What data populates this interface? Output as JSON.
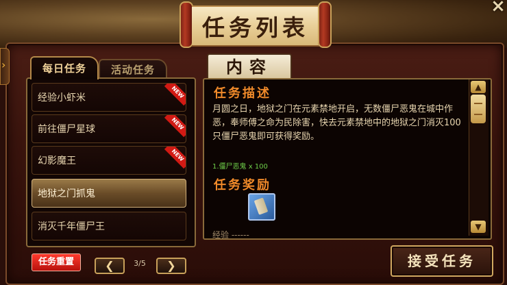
{
  "window": {
    "title": "任务列表",
    "close_label": "×",
    "side_arrow": "›"
  },
  "tabs": [
    {
      "label": "每日任务",
      "active": true
    },
    {
      "label": "活动任务",
      "active": false
    }
  ],
  "tasks": [
    {
      "label": "经验小虾米",
      "badge": "NEW"
    },
    {
      "label": "前往僵尸星球",
      "badge": "NEW"
    },
    {
      "label": "幻影魔王",
      "badge": "NEW"
    },
    {
      "label": "地狱之门抓鬼",
      "selected": true
    },
    {
      "label": "消灭千年僵尸王"
    }
  ],
  "pager": {
    "reset_label": "任务重置",
    "prev": "❮",
    "next": "❯",
    "page_text": "3/5"
  },
  "content": {
    "tab_label": "内容",
    "desc_title": "任务描述",
    "desc_text": "月圆之日，地狱之门在元素禁地开启，无数僵尸恶鬼在城中作恶，奉师傅之命为民除害，快去元素禁地中的地狱之门消灭100只僵尸恶鬼即可获得奖励。",
    "goal": "1.僵尸恶鬼 x 100",
    "reward_title": "任务奖励",
    "reward_icon": "scroll-item-icon",
    "exp_text": "经验 ------"
  },
  "scrollbar": {
    "up": "▲",
    "down": "▼"
  },
  "accept_label": "接受任务"
}
